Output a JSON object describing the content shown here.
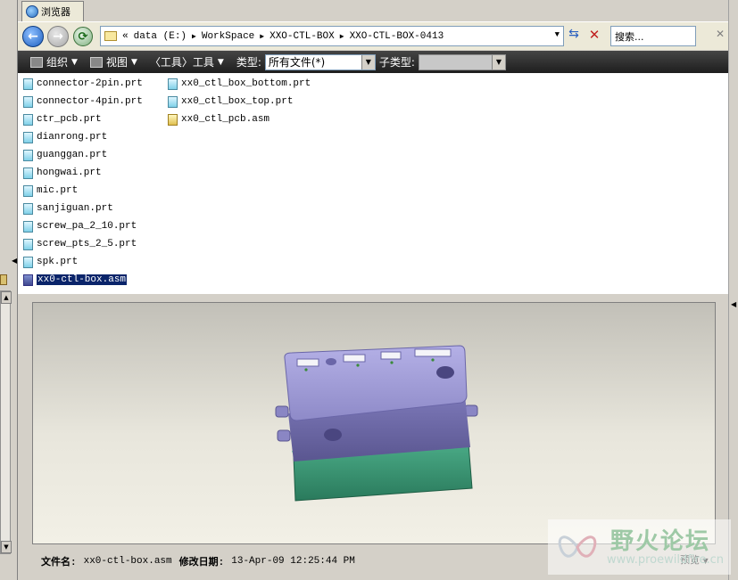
{
  "tab": {
    "label": "浏览器"
  },
  "address": {
    "chevron": "«",
    "crumbs": [
      "data (E:)",
      "WorkSpace",
      "XXO-CTL-BOX",
      "XXO-CTL-BOX-0413"
    ]
  },
  "search": {
    "placeholder": "搜索..."
  },
  "toolbar": {
    "organize": "组织",
    "view": "视图",
    "tools": "〈工具〉工具",
    "type_label": "类型:",
    "type_value": "所有文件(*)",
    "subtype_label": "子类型:"
  },
  "files": [
    "connector-2pin.prt",
    "connector-4pin.prt",
    "ctr_pcb.prt",
    "dianrong.prt",
    "guanggan.prt",
    "hongwai.prt",
    "mic.prt",
    "sanjiguan.prt",
    "screw_pa_2_10.prt",
    "screw_pts_2_5.prt",
    "spk.prt",
    "xx0-ctl-box.asm",
    "xx0_ctl_box_bottom.prt",
    "xx0_ctl_box_top.prt",
    "xx0_ctl_pcb.asm"
  ],
  "status": {
    "filename_label": "文件名:",
    "filename_value": "xx0-ctl-box.asm",
    "date_label": "修改日期:",
    "date_value": "13-Apr-09 12:25:44 PM"
  },
  "preview_button": "预览",
  "watermark": {
    "title": "野火论坛",
    "url": "www.proewildfire.cn"
  },
  "colors": {
    "toolbar_bg": "#2a2a2a",
    "selection": "#0a246a",
    "model_top": "#9e9ad8",
    "model_base": "#3a9a7a"
  }
}
